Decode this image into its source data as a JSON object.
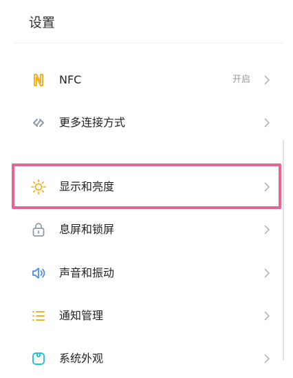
{
  "header": {
    "title": "设置"
  },
  "items": [
    {
      "label": "NFC",
      "value": "开启",
      "icon": "nfc-icon"
    },
    {
      "label": "更多连接方式",
      "value": "",
      "icon": "link-icon"
    },
    {
      "label": "显示和亮度",
      "value": "",
      "icon": "sun-icon"
    },
    {
      "label": "息屏和锁屏",
      "value": "",
      "icon": "lock-icon"
    },
    {
      "label": "声音和振动",
      "value": "",
      "icon": "speaker-icon"
    },
    {
      "label": "通知管理",
      "value": "",
      "icon": "list-icon"
    },
    {
      "label": "系统外观",
      "value": "",
      "icon": "appearance-icon"
    }
  ],
  "colors": {
    "highlight": "#e8638f",
    "icon_yellow": "#f2b322",
    "icon_blue": "#4a8af4",
    "icon_cyan": "#1fc1d6",
    "icon_gray": "#8e99a6"
  }
}
